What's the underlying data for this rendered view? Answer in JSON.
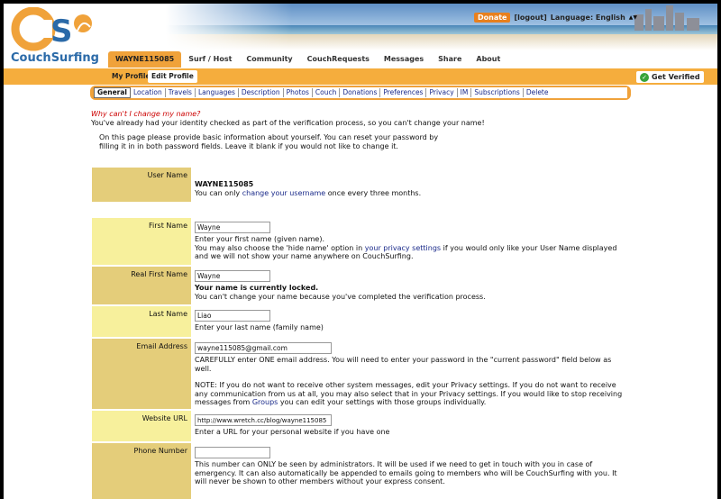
{
  "header": {
    "logo_text": "CouchSurfing",
    "donate": "Donate",
    "logout": "[logout]",
    "language": "Language: English",
    "nav": [
      "WAYNE115085",
      "Surf / Host",
      "Community",
      "CouchRequests",
      "Messages",
      "Share",
      "About"
    ]
  },
  "subnav": {
    "my_profile": "My Profile",
    "edit_profile": "Edit Profile",
    "get_verified": "Get Verified"
  },
  "tabs": [
    "General",
    "Location",
    "Travels",
    "Languages",
    "Description",
    "Photos",
    "Couch",
    "Donations",
    "Preferences",
    "Privacy",
    "IM",
    "Subscriptions",
    "Delete"
  ],
  "page": {
    "why": "Why can't I change my name?",
    "already": "You've already had your identity checked as part of the verification process, so you can't change your name!",
    "intro": "On this page please provide basic information about yourself. You can reset your password by filling it in in both password fields. Leave it blank if you would not like to change it."
  },
  "form": {
    "username": {
      "label": "User Name",
      "value": "WAYNE115085",
      "pre": "You can only ",
      "link": "change your username",
      "post": " once every three months."
    },
    "first": {
      "label": "First Name",
      "value": "Wayne",
      "help1": "Enter your first name (given name).",
      "help2_pre": "You may also choose the 'hide name' option in ",
      "help2_link": "your privacy settings",
      "help2_post": " if you would only like your User Name displayed and we will not show your name anywhere on CouchSurfing."
    },
    "realfirst": {
      "label": "Real First Name",
      "value": "Wayne",
      "bold": "Your name is currently locked.",
      "help": "You can't change your name because you've completed the verification process."
    },
    "last": {
      "label": "Last Name",
      "value": "Liao",
      "help": "Enter your last name (family name)"
    },
    "email": {
      "label": "Email Address",
      "value": "wayne115085@gmail.com",
      "help1": "CAREFULLY enter ONE email address. You will need to enter your password in the \"current password\" field below as well.",
      "help2_pre": "NOTE: If you do not want to receive other system messages, edit your Privacy settings. If you do not want to receive any communication from us at all, you may also select that in your Privacy settings. If you would like to stop receiving messages from ",
      "help2_link": "Groups",
      "help2_post": " you can edit your settings with those groups individually."
    },
    "website": {
      "label": "Website URL",
      "value": "http://www.wretch.cc/blog/wayne115085",
      "help": "Enter a URL for your personal website if you have one"
    },
    "phone": {
      "label": "Phone Number",
      "value": "",
      "help": "This number can ONLY be seen by administrators. It will be used if we need to get in touch with you in case of emergency. It can also automatically be appended to emails going to members who will be CouchSurfing with you. It will never be shown to other members without your express consent."
    }
  },
  "colors": {
    "accent": "#f0a23a",
    "label_dark": "#e4cd7a",
    "label_light": "#f7f09c",
    "link": "#1a2a8a",
    "error": "#cc0000"
  }
}
